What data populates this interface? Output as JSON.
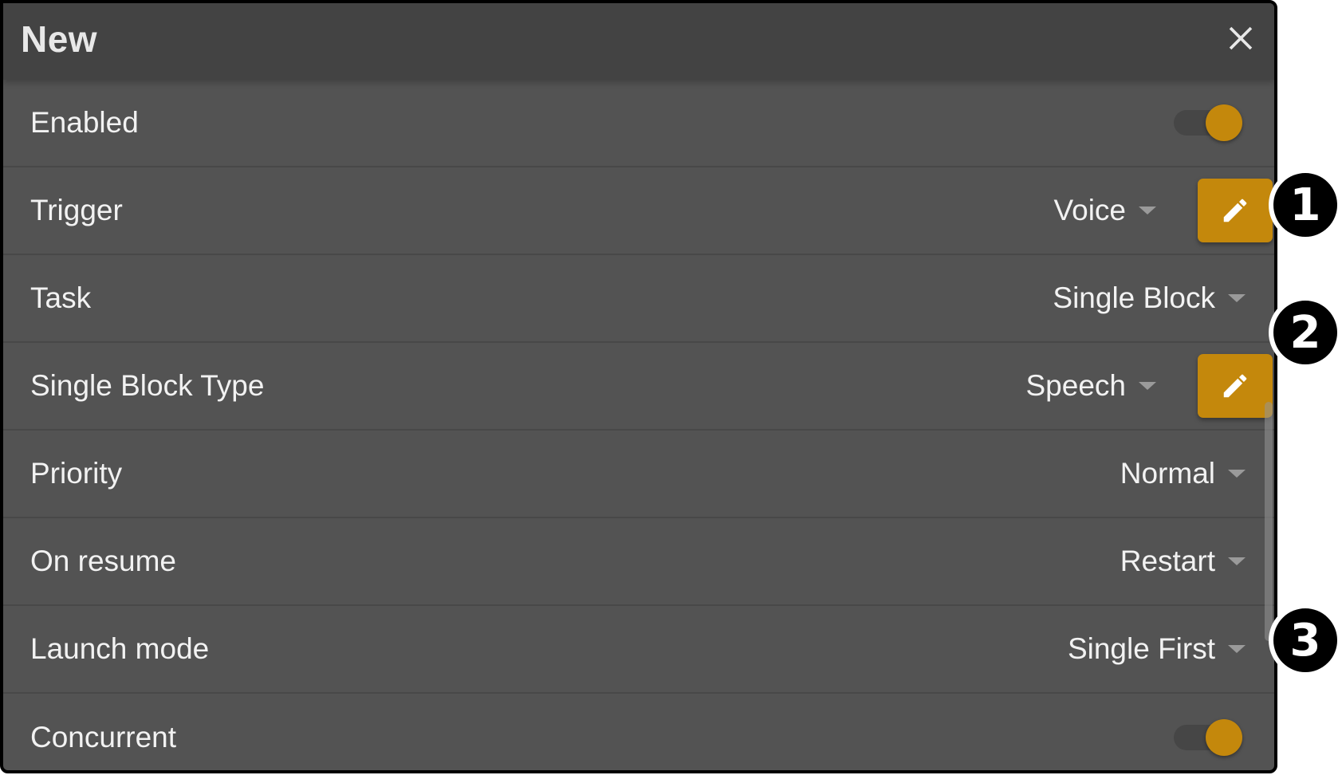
{
  "dialog": {
    "title": "New",
    "close_icon": "close-icon",
    "rows": [
      {
        "label": "Enabled",
        "type": "toggle",
        "checked": true
      },
      {
        "label": "Trigger",
        "type": "select",
        "value": "Voice",
        "has_edit": true
      },
      {
        "label": "Task",
        "type": "select",
        "value": "Single Block"
      },
      {
        "label": "Single Block Type",
        "type": "select",
        "value": "Speech",
        "has_edit": true
      },
      {
        "label": "Priority",
        "type": "select",
        "value": "Normal"
      },
      {
        "label": "On resume",
        "type": "select",
        "value": "Restart"
      },
      {
        "label": "Launch mode",
        "type": "select",
        "value": "Single First"
      },
      {
        "label": "Concurrent",
        "type": "toggle",
        "checked": true
      }
    ]
  },
  "callouts": [
    "1",
    "2",
    "3"
  ],
  "colors": {
    "accent": "#c4880c",
    "header_bg": "#434343",
    "body_bg": "#535353"
  }
}
